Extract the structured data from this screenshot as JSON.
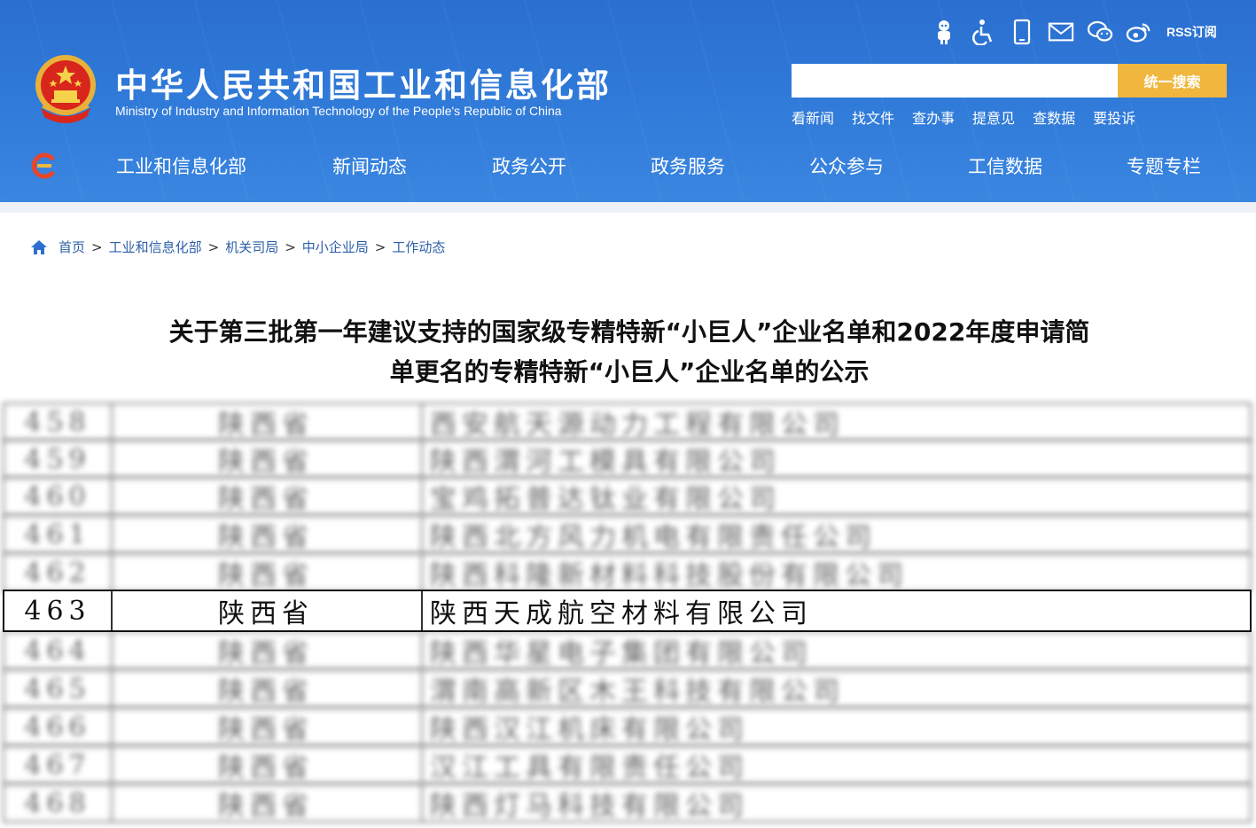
{
  "header": {
    "title": "中华人民共和国工业和信息化部",
    "subtitle": "Ministry of Industry and Information Technology of the People's Republic of China",
    "rss_label": "RSS订阅",
    "search": {
      "placeholder": "",
      "button_label": "统一搜索"
    },
    "quick_links": [
      "看新闻",
      "找文件",
      "查办事",
      "提意见",
      "查数据",
      "要投诉"
    ],
    "icons": [
      "robot-icon",
      "accessibility-icon",
      "mobile-icon",
      "mail-icon",
      "wechat-icon",
      "weibo-icon"
    ]
  },
  "nav": [
    "工业和信息化部",
    "新闻动态",
    "政务公开",
    "政务服务",
    "公众参与",
    "工信数据",
    "专题专栏"
  ],
  "breadcrumb": [
    "首页",
    "工业和信息化部",
    "机关司局",
    "中小企业局",
    "工作动态"
  ],
  "article": {
    "title_line1": "关于第三批第一年建议支持的国家级专精特新“小巨人”企业名单和2022年度申请简",
    "title_line2": "单更名的专精特新“小巨人”企业名单的公示"
  },
  "table": {
    "rows": [
      {
        "num": "458",
        "province": "陕西省",
        "company": "西安航天源动力工程有限公司",
        "blurred": true
      },
      {
        "num": "459",
        "province": "陕西省",
        "company": "陕西渭河工模具有限公司",
        "blurred": true
      },
      {
        "num": "460",
        "province": "陕西省",
        "company": "宝鸡拓普达钛业有限公司",
        "blurred": true
      },
      {
        "num": "461",
        "province": "陕西省",
        "company": "陕西北方风力机电有限责任公司",
        "blurred": true
      },
      {
        "num": "462",
        "province": "陕西省",
        "company": "陕西科隆新材料科技股份有限公司",
        "blurred": true
      },
      {
        "num": "463",
        "province": "陕西省",
        "company": "陕西天成航空材料有限公司",
        "blurred": false
      },
      {
        "num": "464",
        "province": "陕西省",
        "company": "陕西华星电子集团有限公司",
        "blurred": true
      },
      {
        "num": "465",
        "province": "陕西省",
        "company": "渭南高新区木王科技有限公司",
        "blurred": true
      },
      {
        "num": "466",
        "province": "陕西省",
        "company": "陕西汉江机床有限公司",
        "blurred": true
      },
      {
        "num": "467",
        "province": "陕西省",
        "company": "汉江工具有限责任公司",
        "blurred": true
      },
      {
        "num": "468",
        "province": "陕西省",
        "company": "陕西灯马科技有限公司",
        "blurred": true
      }
    ]
  },
  "colors": {
    "header_blue": "#2f79d8",
    "search_button": "#f0b63d",
    "breadcrumb_link": "#2d5fa8"
  }
}
